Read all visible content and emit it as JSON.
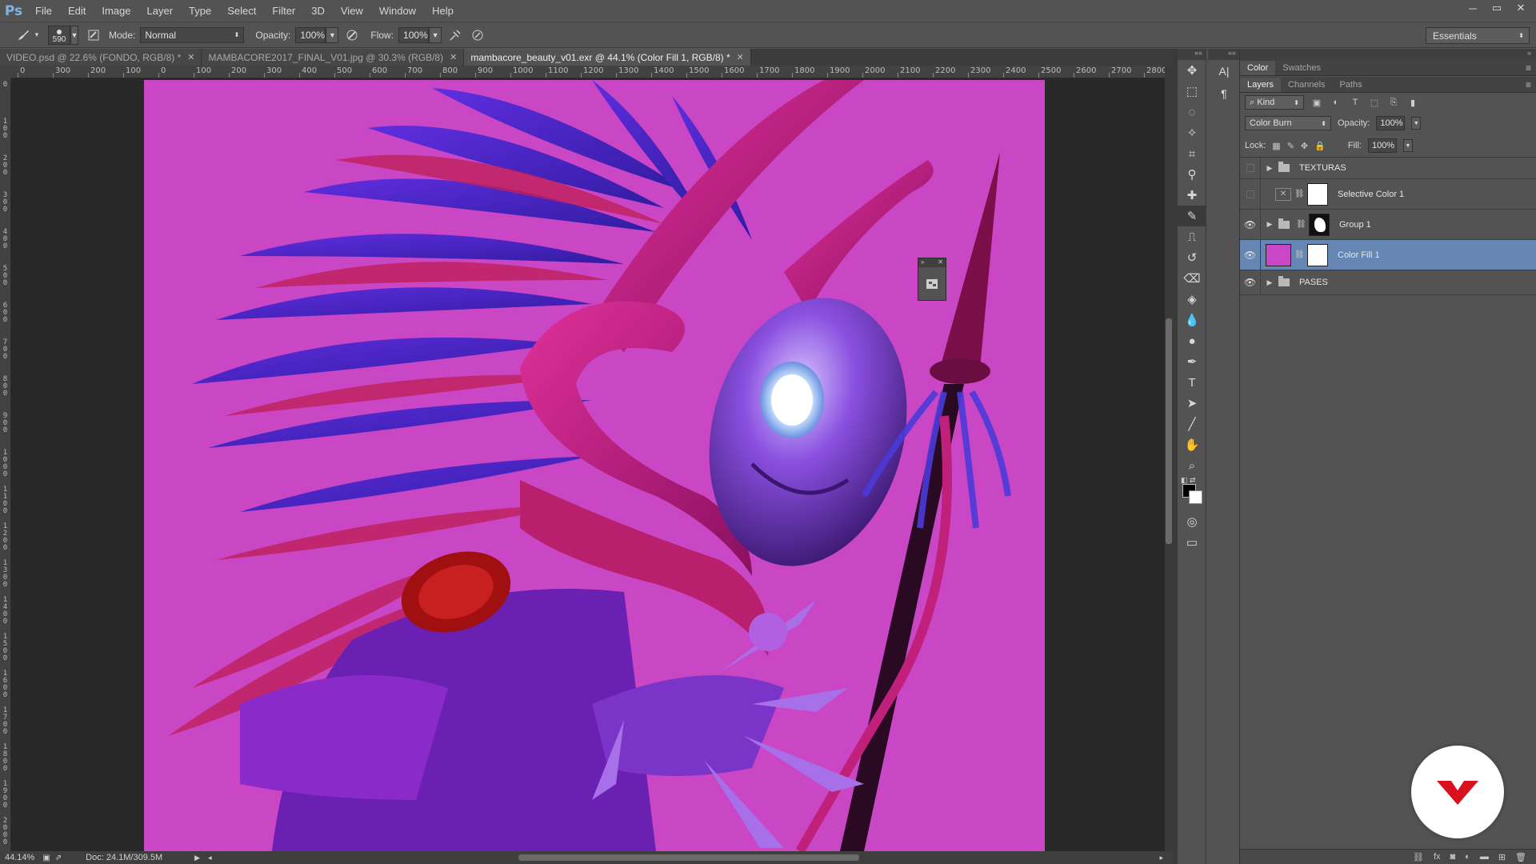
{
  "app": {
    "logo": "Ps"
  },
  "menu": [
    "File",
    "Edit",
    "Image",
    "Layer",
    "Type",
    "Select",
    "Filter",
    "3D",
    "View",
    "Window",
    "Help"
  ],
  "window_controls": [
    "─",
    "▭",
    "✕"
  ],
  "options": {
    "brush_size": "590",
    "mode_label": "Mode:",
    "mode_value": "Normal",
    "opacity_label": "Opacity:",
    "opacity_value": "100%",
    "flow_label": "Flow:",
    "flow_value": "100%",
    "workspace": "Essentials"
  },
  "tabs": [
    {
      "label": "VIDEO.psd @ 22.6% (FONDO, RGB/8) *",
      "active": false
    },
    {
      "label": "MAMBACORE2017_FINAL_V01.jpg @ 30.3% (RGB/8)",
      "active": false
    },
    {
      "label": "mambacore_beauty_v01.exr @ 44.1% (Color Fill 1, RGB/8) *",
      "active": true
    }
  ],
  "ruler_top": [
    "0",
    "300",
    "200",
    "100",
    "0",
    "100",
    "200",
    "300",
    "400",
    "500",
    "600",
    "700",
    "800",
    "900",
    "1000",
    "1100",
    "1200",
    "1300",
    "1400",
    "1500",
    "1600",
    "1700",
    "1800",
    "1900",
    "2000",
    "2100",
    "2200",
    "2300",
    "2400",
    "2500",
    "2600",
    "2700",
    "2800"
  ],
  "ruler_left": [
    "0",
    "1 0 0",
    "2 0 0",
    "3 0 0",
    "4 0 0",
    "5 0 0",
    "6 0 0",
    "7 0 0",
    "8 0 0",
    "9 0 0",
    "1 0 0 0",
    "1 1 0 0",
    "1 2 0 0",
    "1 3 0 0",
    "1 4 0 0",
    "1 5 0 0",
    "1 6 0 0",
    "1 7 0 0",
    "1 8 0 0",
    "1 9 0 0",
    "2 0 0 0"
  ],
  "status": {
    "zoom": "44.14%",
    "doc": "Doc: 24.1M/309.5M"
  },
  "colors": {
    "canvas_bg": "#c947c5",
    "selected_layer": "#6687b3",
    "brand_red": "#d8111d"
  },
  "panels": {
    "top_tabs": [
      "Color",
      "Swatches"
    ],
    "layer_tabs": [
      "Layers",
      "Channels",
      "Paths"
    ],
    "kind_label": "Kind",
    "blend_mode": "Color Burn",
    "opacity_label": "Opacity:",
    "opacity_value": "100%",
    "lock_label": "Lock:",
    "fill_label": "Fill:",
    "fill_value": "100%"
  },
  "layers": [
    {
      "name": "TEXTURAS",
      "type": "group",
      "visible": false
    },
    {
      "name": "Selective Color 1",
      "type": "adjustment",
      "visible": false
    },
    {
      "name": "Group 1",
      "type": "group-masked",
      "visible": true
    },
    {
      "name": "Color Fill 1",
      "type": "fill",
      "visible": true,
      "selected": true
    },
    {
      "name": "PASES",
      "type": "group",
      "visible": true
    }
  ]
}
